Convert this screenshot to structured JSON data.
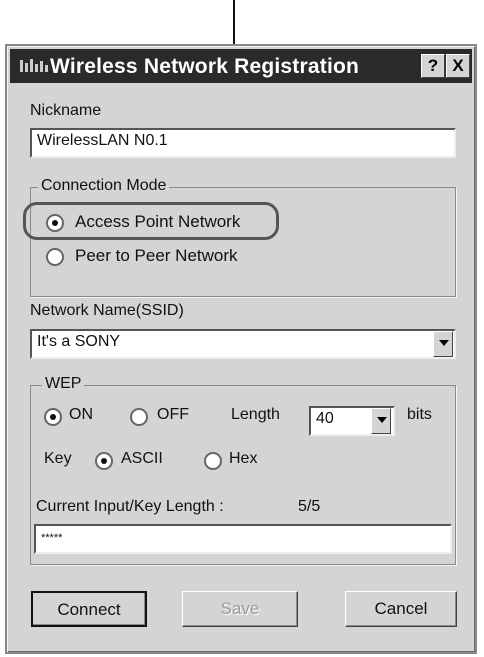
{
  "window": {
    "title": "Wireless Network Registration",
    "help_label": "?",
    "close_label": "X"
  },
  "nickname": {
    "label": "Nickname",
    "value": "WirelessLAN N0.1"
  },
  "connection_mode": {
    "title": "Connection Mode",
    "options": [
      {
        "label": "Access Point Network",
        "selected": true
      },
      {
        "label": "Peer to Peer Network",
        "selected": false
      }
    ]
  },
  "network_name": {
    "label": "Network Name(SSID)",
    "value": "It's a SONY"
  },
  "wep": {
    "title": "WEP",
    "on_label": "ON",
    "off_label": "OFF",
    "selected": "ON",
    "length_label": "Length",
    "length_value": "40",
    "bits_label": "bits",
    "key_label": "Key",
    "ascii_label": "ASCII",
    "hex_label": "Hex",
    "key_type": "ASCII",
    "current_label": "Current Input/Key Length :",
    "current_value": "5/5",
    "key_value": "*****"
  },
  "buttons": {
    "connect": "Connect",
    "save": "Save",
    "cancel": "Cancel"
  },
  "icons": {
    "app": "wireless-network-icon",
    "dropdown": "chevron-down-icon"
  }
}
